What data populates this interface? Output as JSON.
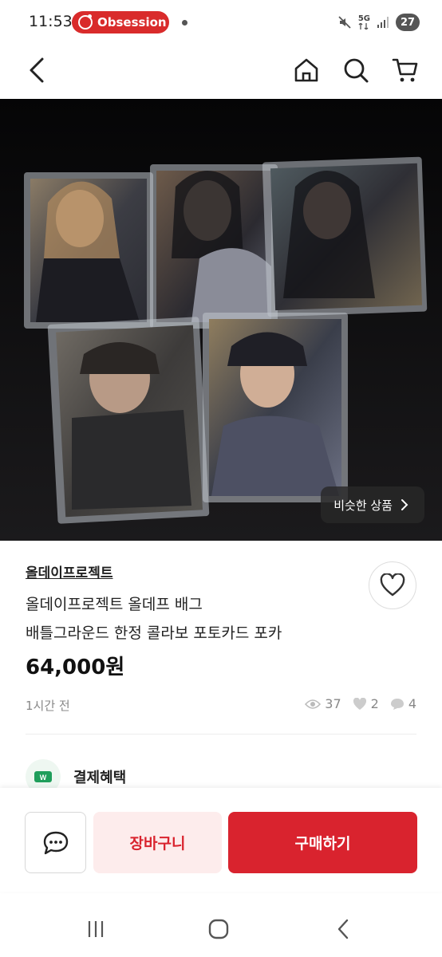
{
  "status_bar": {
    "time": "11:53",
    "notification_app": "Obsession",
    "network": "5G",
    "battery": "27"
  },
  "product": {
    "shop_name": "올데이프로젝트",
    "title_line1": "올데이프로젝트 올데프 배그",
    "title_line2": "배틀그라운드 한정 콜라보 포토카드 포카",
    "price": "64,000원",
    "posted": "1시간 전",
    "views": "37",
    "likes": "2",
    "chats": "4",
    "similar_label": "비슷한 상품",
    "benefit_label": "결제혜택",
    "benefit_icon_text": "W"
  },
  "actions": {
    "cart_label": "장바구니",
    "buy_label": "구매하기"
  },
  "colors": {
    "brand_red": "#d9232e",
    "cart_bg": "#fdecec"
  },
  "icons": [
    "back-icon",
    "home-icon",
    "search-icon",
    "cart-icon",
    "heart-icon",
    "chevron-right-icon",
    "eye-icon",
    "chat-bubble-icon",
    "recent-apps-icon",
    "home-circle-icon",
    "system-back-icon"
  ]
}
